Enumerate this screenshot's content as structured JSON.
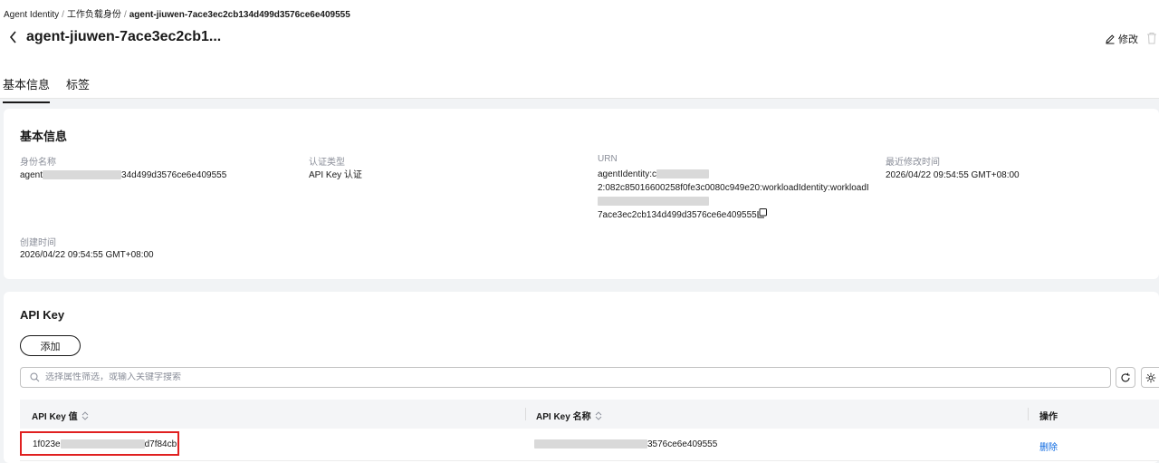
{
  "breadcrumb": {
    "items": [
      "Agent Identity",
      "工作负载身份"
    ],
    "separator": "/",
    "current": "agent-jiuwen-7ace3ec2cb134d499d3576ce6e409555"
  },
  "header": {
    "title": "agent-jiuwen-7ace3ec2cb1...",
    "edit_label": "修改"
  },
  "tabs": [
    {
      "label": "基本信息",
      "active": true
    },
    {
      "label": "标签",
      "active": false
    }
  ],
  "basic_info": {
    "section_title": "基本信息",
    "identity_name": {
      "label": "身份名称",
      "value_prefix": "agent",
      "value_suffix": "34d499d3576ce6e409555"
    },
    "auth_type": {
      "label": "认证类型",
      "value": "API Key 认证"
    },
    "urn": {
      "label": "URN",
      "line1_prefix": "agentIdentity:c",
      "line2": "2:082c85016600258f0fe3c0080c949e20:workloadIdentity:workloadI",
      "line4": "7ace3ec2cb134d499d3576ce6e409555"
    },
    "last_modified": {
      "label": "最近修改时间",
      "value": "2026/04/22 09:54:55 GMT+08:00"
    },
    "created": {
      "label": "创建时间",
      "value": "2026/04/22 09:54:55 GMT+08:00"
    }
  },
  "api_key_section": {
    "section_title": "API Key",
    "add_label": "添加",
    "search_placeholder": "选择属性筛选，或输入关键字搜索",
    "columns": [
      {
        "label": "API Key 值",
        "sortable": true
      },
      {
        "label": "API Key 名称",
        "sortable": true
      },
      {
        "label": "操作",
        "sortable": false
      }
    ],
    "rows": [
      {
        "key_prefix": "1f023e",
        "key_suffix": "d7f84cb",
        "name_suffix": "3576ce6e409555",
        "action": "删除"
      }
    ]
  },
  "colors": {
    "link": "#0b68e0",
    "highlight": "#e02020",
    "redaction": "#d9d9d9"
  }
}
